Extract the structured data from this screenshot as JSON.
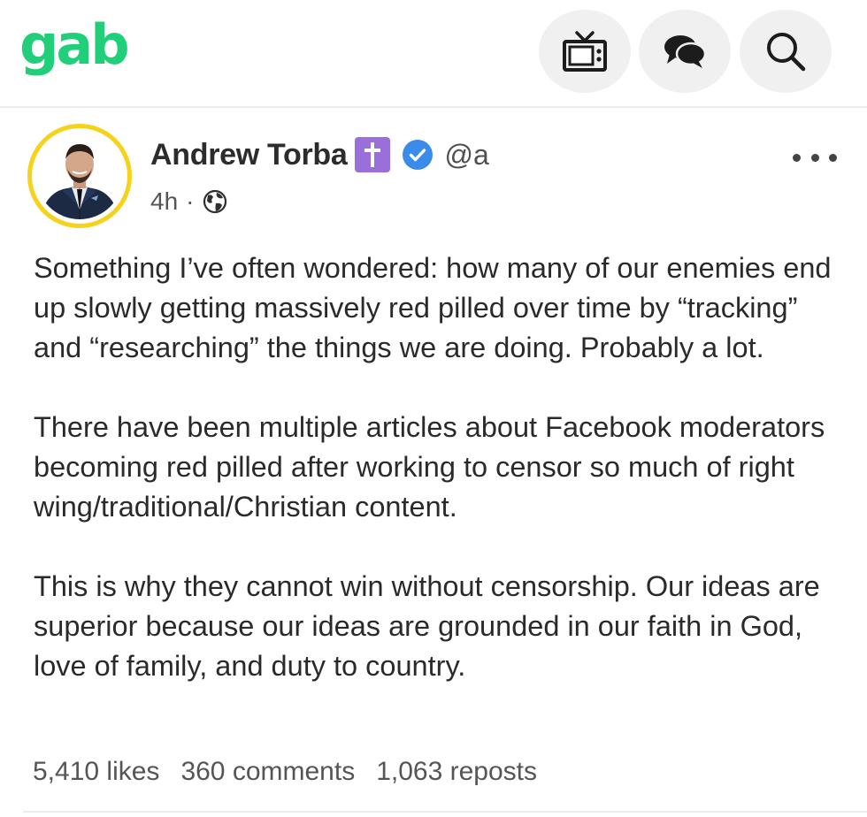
{
  "app": {
    "logo_text": "gab",
    "brand_color": "#21cf7a"
  },
  "nav": {
    "buttons": [
      {
        "icon": "tv-icon"
      },
      {
        "icon": "chat-icon"
      },
      {
        "icon": "search-icon"
      }
    ]
  },
  "post": {
    "author": {
      "display_name": "Andrew Torba",
      "handle": "@a",
      "badges": [
        "cross-badge",
        "verified-badge"
      ]
    },
    "time": "4h",
    "visibility_icon": "globe-icon",
    "paragraphs": [
      "Something I’ve often wondered: how many of our enemies end up slowly getting massively red pilled over time by “tracking” and “researching” the things we are doing. Probably a lot.",
      "There have been multiple articles about Facebook moderators becoming red pilled after working to censor so much of right wing/traditional/Christian content.",
      "This is why they cannot win without censorship. Our ideas are superior because our ideas are grounded in our faith in God, love of family, and duty to country."
    ],
    "stats": {
      "likes": "5,410 likes",
      "comments": "360 comments",
      "reposts": "1,063 reposts"
    },
    "menu_icon": "more-icon"
  }
}
